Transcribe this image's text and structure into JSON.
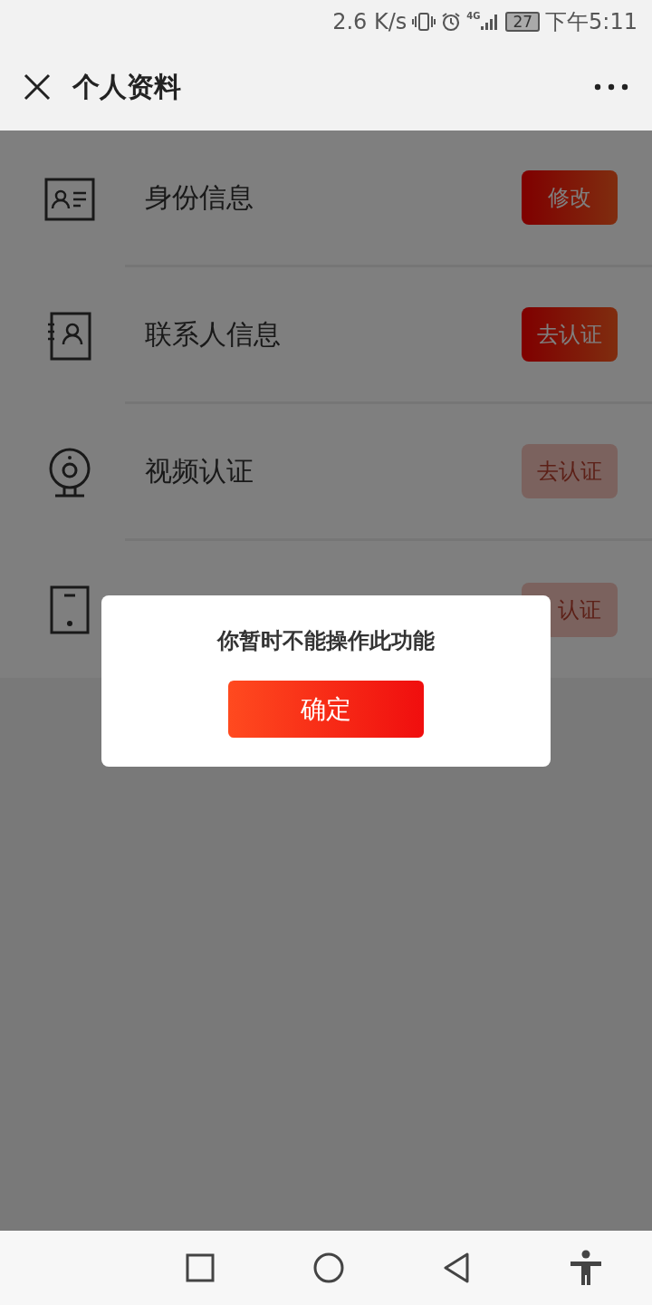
{
  "status_bar": {
    "speed": "2.6 K/s",
    "network": "4G",
    "battery": "27",
    "time": "下午5:11"
  },
  "header": {
    "title": "个人资料"
  },
  "items": [
    {
      "label": "身份信息",
      "action": "修改",
      "disabled": false
    },
    {
      "label": "联系人信息",
      "action": "去认证",
      "disabled": false
    },
    {
      "label": "视频认证",
      "action": "去认证",
      "disabled": true
    },
    {
      "action": "认证",
      "disabled": true
    }
  ],
  "dialog": {
    "message": "你暂时不能操作此功能",
    "confirm": "确定"
  }
}
